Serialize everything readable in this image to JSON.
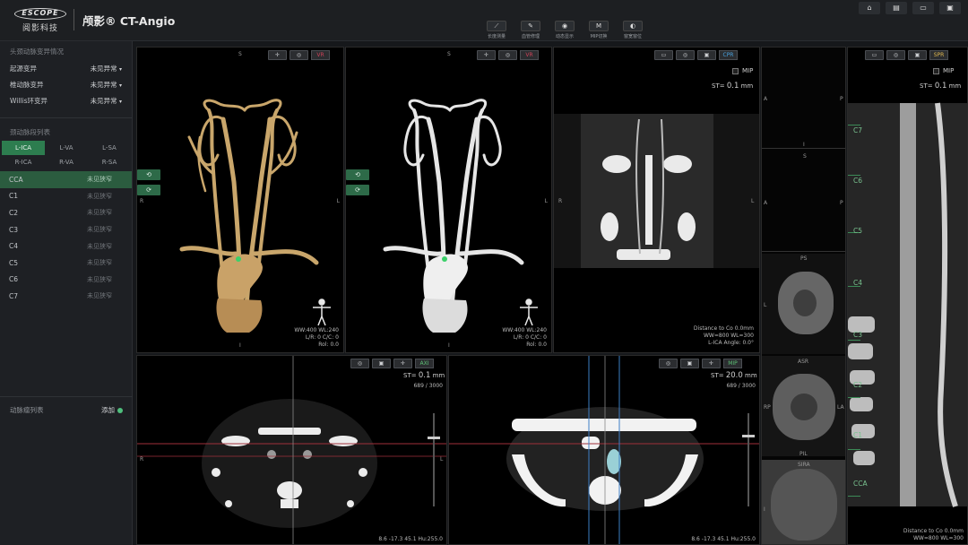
{
  "header": {
    "logo_en": "ESCOPE",
    "logo_cn": "阅影科技",
    "title": "颅影® CT-Angio",
    "tools": [
      {
        "icon": "ruler-icon",
        "glyph": "⟋",
        "label": "长度测量"
      },
      {
        "icon": "vessel-edit-icon",
        "glyph": "✎",
        "label": "血管修理"
      },
      {
        "icon": "viewpoint-icon",
        "glyph": "◉",
        "label": "动态显示"
      },
      {
        "icon": "mip-icon",
        "glyph": "M",
        "label": "MIP切换"
      },
      {
        "icon": "contrast-icon",
        "glyph": "◐",
        "label": "窗宽窗位"
      }
    ],
    "window_buttons": [
      {
        "icon": "home-icon",
        "glyph": "⌂"
      },
      {
        "icon": "report-icon",
        "glyph": "▤"
      },
      {
        "icon": "folder-icon",
        "glyph": "▭"
      },
      {
        "icon": "save-icon",
        "glyph": "▣"
      }
    ]
  },
  "left_panel": {
    "variation_title": "头颈动脉变异情况",
    "variations": [
      {
        "label": "起源变异",
        "value": "未见异常"
      },
      {
        "label": "椎动脉变异",
        "value": "未见异常"
      },
      {
        "label": "Willis环变异",
        "value": "未见异常"
      }
    ],
    "segments_title": "颈动脉段列表",
    "vessel_tabs": [
      "L-ICA",
      "L-VA",
      "L-SA",
      "R-ICA",
      "R-VA",
      "R-SA"
    ],
    "segments": [
      {
        "name": "CCA",
        "status": "未见狭窄"
      },
      {
        "name": "C1",
        "status": "未见狭窄"
      },
      {
        "name": "C2",
        "status": "未见狭窄"
      },
      {
        "name": "C3",
        "status": "未见狭窄"
      },
      {
        "name": "C4",
        "status": "未见狭窄"
      },
      {
        "name": "C5",
        "status": "未见狭窄"
      },
      {
        "name": "C6",
        "status": "未见狭窄"
      },
      {
        "name": "C7",
        "status": "未见狭窄"
      }
    ],
    "plaque_label": "动脉瘤列表",
    "add_label": "添加"
  },
  "vr1": {
    "tag": "VR",
    "tag_color": "#d0435a",
    "top": "S",
    "bottom": "I",
    "right": "L",
    "left": "R",
    "info": [
      "WW:400 WL:240",
      "L/R: 0   C/C: 0",
      "Rol: 0.0"
    ]
  },
  "vr2": {
    "tag": "VR",
    "tag_color": "#d0435a",
    "top": "S",
    "bottom": "I",
    "right": "L",
    "left": "R",
    "info": [
      "WW:400 WL:240",
      "L/R: 0   C/C: 0",
      "Rol: 0.0"
    ]
  },
  "cpr": {
    "tag": "CPR",
    "tag_color": "#4aa3df",
    "mip": "MIP",
    "st_label": "ST=",
    "st_value": "0.1",
    "st_unit": "mm",
    "left": "R",
    "right": "L",
    "info": [
      "Distance to Co 0.0mm",
      "WW=800 WL=300",
      "L-ICA Angle: 0.0°"
    ]
  },
  "cross": {
    "labels": [
      "A",
      "P",
      "I",
      "S",
      "A",
      "P",
      "L",
      "PS",
      "ASR",
      "RP",
      "LA",
      "PIL",
      "SIRA",
      "I"
    ]
  },
  "spr": {
    "tag": "SPR",
    "tag_color": "#e0b850",
    "mip": "MIP",
    "st_label": "ST=",
    "st_value": "0.1",
    "st_unit": "mm",
    "segments": [
      "C7",
      "C6",
      "C5",
      "C4",
      "C3",
      "C2",
      "C1",
      "CCA"
    ],
    "info": [
      "Distance to Co 0.0mm",
      "WW=800 WL=300"
    ]
  },
  "axial": {
    "tag": "AXI",
    "tag_color": "#5cbf74",
    "st_label": "ST=",
    "st_value": "0.1",
    "st_unit": "mm",
    "slice": "689 / 3000",
    "left": "R",
    "right": "L",
    "coords": "8.6 -17.3 45.1 Hu:255.0"
  },
  "mpr": {
    "tag": "MIP",
    "tag_color": "#5cbf74",
    "st_label": "ST=",
    "st_value": "20.0",
    "st_unit": "mm",
    "slice": "689 / 3000",
    "coords": "8.6 -17.3 45.1 Hu:255.0"
  }
}
